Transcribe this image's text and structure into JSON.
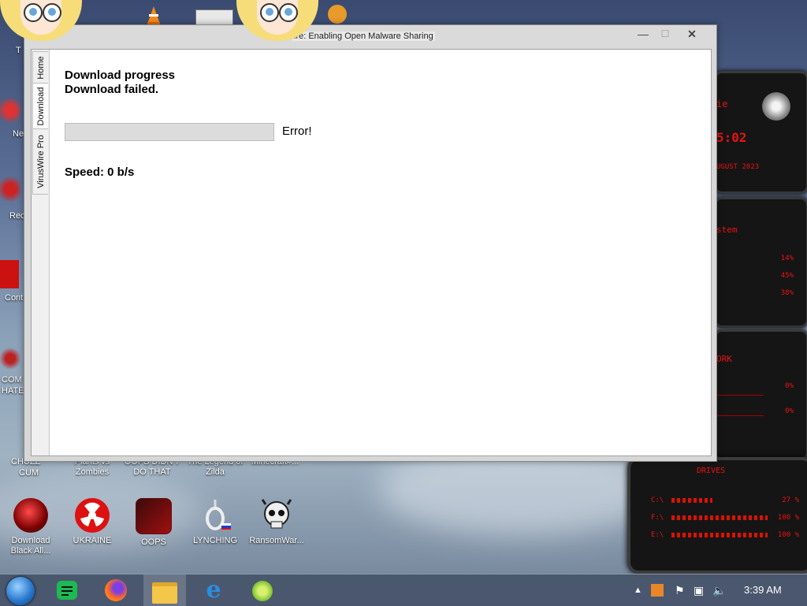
{
  "window": {
    "title": "ire: Enabling Open Malware Sharing",
    "minimize_glyph": "—",
    "maximize_glyph": "☐",
    "close_glyph": "✕",
    "tabs": [
      {
        "label": "Home"
      },
      {
        "label": "Download"
      },
      {
        "label": "VirusWire Pro"
      }
    ],
    "content": {
      "heading": "Download progress",
      "status": "Download failed.",
      "progress_percent": 0,
      "progress_label": "Error!",
      "speed": "Speed: 0 b/s"
    }
  },
  "desktop": {
    "left_partial_labels": [
      "T",
      "Ne",
      "Rec",
      "Cont",
      "COM",
      "HATE",
      "CHUZZ",
      "CUM"
    ],
    "icons_row1": [
      {
        "label": "Plants vs Zombies",
        "icon": "plants-vs-zombies-icon"
      },
      {
        "label": "OOPS DIDN'T DO THAT",
        "icon": "oops-icon"
      },
      {
        "label": "The Legend of Zilda",
        "icon": "zilda-icon"
      },
      {
        "label": "Minecraft#...",
        "icon": "minecraft-icon"
      }
    ],
    "icons_row2": [
      {
        "label": "Download Black All...",
        "icon": "download-black-icon"
      },
      {
        "label": "UKRAINE",
        "icon": "radiation-icon"
      },
      {
        "label": "OOPS",
        "icon": "oops-icon"
      },
      {
        "label": "LYNCHING",
        "icon": "noose-icon"
      },
      {
        "label": "RansomWar...",
        "icon": "skull-icon"
      }
    ]
  },
  "gadget": {
    "clock_fragment": "5:02",
    "date_fragment": "UGUST 2023",
    "system_label": "stem",
    "system_values": [
      "14%",
      "45%",
      "38%"
    ],
    "network_label": "ORK",
    "network_values": [
      "0%",
      "0%"
    ],
    "drives_label": "DRIVES",
    "drives": [
      {
        "label": "C:\\",
        "value": "27 %"
      },
      {
        "label": "F:\\",
        "value": "100 %"
      },
      {
        "label": "E:\\",
        "value": "100 %"
      }
    ]
  },
  "taskbar": {
    "pinned": [
      "start-orb",
      "notes-icon",
      "firefox-icon",
      "file-explorer-icon",
      "internet-explorer-icon",
      "app-lime-icon"
    ],
    "time": "3:39 AM"
  },
  "colors": {
    "window_bg": "#ffffff",
    "accent_red": "#e11111",
    "taskbar": "#46546a"
  }
}
